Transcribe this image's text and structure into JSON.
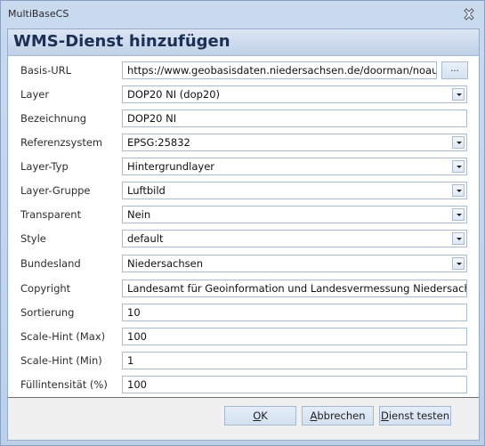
{
  "window": {
    "title": "MultiBaseCS",
    "close_icon": "close-icon"
  },
  "dialog": {
    "title": "WMS-Dienst hinzufügen"
  },
  "form": {
    "basis_url": {
      "label": "Basis-URL",
      "value": "https://www.geobasisdaten.niedersachsen.de/doorman/noauth/w",
      "browse_label": "..."
    },
    "layer": {
      "label": "Layer",
      "value": "DOP20 NI (dop20)"
    },
    "bezeichnung": {
      "label": "Bezeichnung",
      "value": "DOP20 NI"
    },
    "referenzsystem": {
      "label": "Referenzsystem",
      "value": "EPSG:25832"
    },
    "layer_typ": {
      "label": "Layer-Typ",
      "value": "Hintergrundlayer"
    },
    "layer_gruppe": {
      "label": "Layer-Gruppe",
      "value": "Luftbild"
    },
    "transparent": {
      "label": "Transparent",
      "value": "Nein"
    },
    "style": {
      "label": "Style",
      "value": "default"
    },
    "bundesland": {
      "label": "Bundesland",
      "value": "Niedersachsen"
    },
    "copyright": {
      "label": "Copyright",
      "value": "Landesamt für Geoinformation und Landesvermessung Niedersachsen (L"
    },
    "sortierung": {
      "label": "Sortierung",
      "value": "10"
    },
    "scale_max": {
      "label": "Scale-Hint (Max)",
      "value": "100"
    },
    "scale_min": {
      "label": "Scale-Hint (Min)",
      "value": "1"
    },
    "fuellintensitaet": {
      "label": "Füllintensität (%)",
      "value": "100"
    }
  },
  "buttons": {
    "ok": {
      "mnemonic": "O",
      "rest": "K"
    },
    "cancel": {
      "mnemonic": "A",
      "rest": "bbrechen"
    },
    "test": {
      "mnemonic": "D",
      "rest": "ienst testen"
    }
  }
}
